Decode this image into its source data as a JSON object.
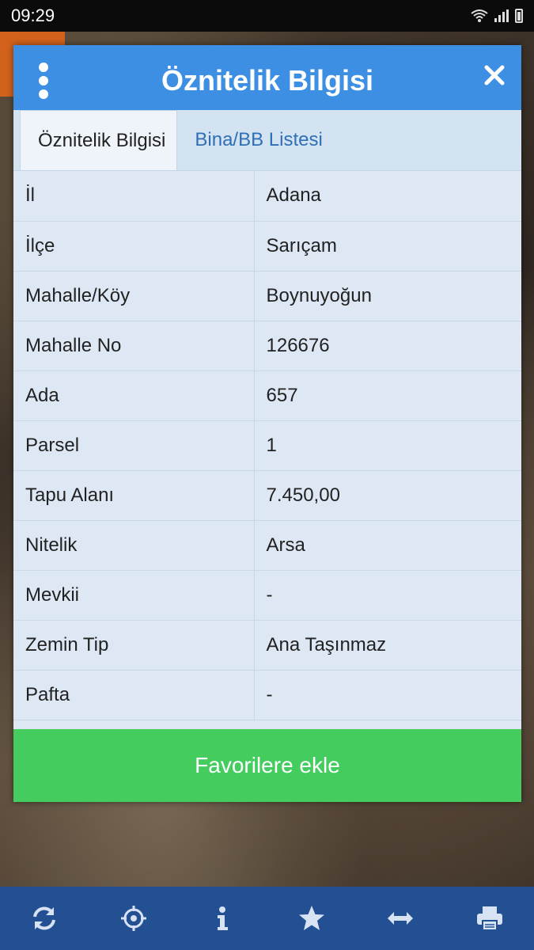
{
  "status_bar": {
    "time": "09:29"
  },
  "dialog": {
    "title": "Öznitelik Bilgisi",
    "tabs": [
      {
        "label": "Öznitelik Bilgisi",
        "active": true
      },
      {
        "label": "Bina/BB Listesi",
        "active": false
      }
    ],
    "rows": [
      {
        "key": "İl",
        "value": "Adana"
      },
      {
        "key": "İlçe",
        "value": "Sarıçam"
      },
      {
        "key": "Mahalle/Köy",
        "value": "Boynuyoğun"
      },
      {
        "key": "Mahalle No",
        "value": "126676"
      },
      {
        "key": "Ada",
        "value": "657"
      },
      {
        "key": "Parsel",
        "value": "1"
      },
      {
        "key": "Tapu Alanı",
        "value": "7.450,00"
      },
      {
        "key": "Nitelik",
        "value": "Arsa"
      },
      {
        "key": "Mevkii",
        "value": "-"
      },
      {
        "key": "Zemin Tip",
        "value": "Ana Taşınmaz"
      },
      {
        "key": "Pafta",
        "value": "-"
      }
    ],
    "favorite_button": "Favorilere ekle"
  },
  "toolbar": {
    "icons": [
      "refresh-icon",
      "locate-icon",
      "info-icon",
      "star-icon",
      "measure-icon",
      "print-icon"
    ]
  },
  "colors": {
    "header": "#3d8fe4",
    "favorite_button": "#44cc5e",
    "toolbar": "#234f93"
  }
}
